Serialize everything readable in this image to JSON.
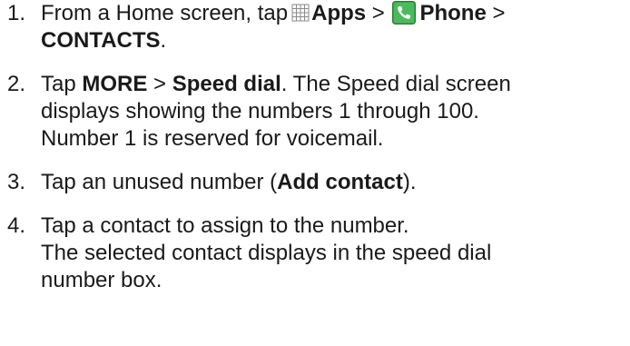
{
  "steps": [
    {
      "number": "1.",
      "line1_pre": "From a Home screen, tap",
      "apps_icon": "apps-grid-icon",
      "apps": "Apps",
      "sep1": ">",
      "phone_icon": "phone-app-icon",
      "phone": "Phone",
      "sep2": ">",
      "contacts": "CONTACTS",
      "end": "."
    },
    {
      "number": "2.",
      "t1": "Tap",
      "more": "MORE",
      "sep": ">",
      "speed_dial": "Speed dial",
      "t2": ". The Speed dial screen",
      "line2": "displays showing the numbers 1 through 100.",
      "line3": "Number 1 is reserved for voicemail."
    },
    {
      "number": "3.",
      "t1": "Tap an unused number (",
      "add_contact": "Add contact",
      "t2": ")."
    },
    {
      "number": "4.",
      "line1": "Tap a contact to assign to the number.",
      "line2": "The selected contact displays in the speed dial",
      "line3": "number box."
    }
  ],
  "colors": {
    "text": "#1a1a1a",
    "phone_icon_green": "#3aa14a",
    "apps_icon_gray": "#8a8a8a"
  }
}
